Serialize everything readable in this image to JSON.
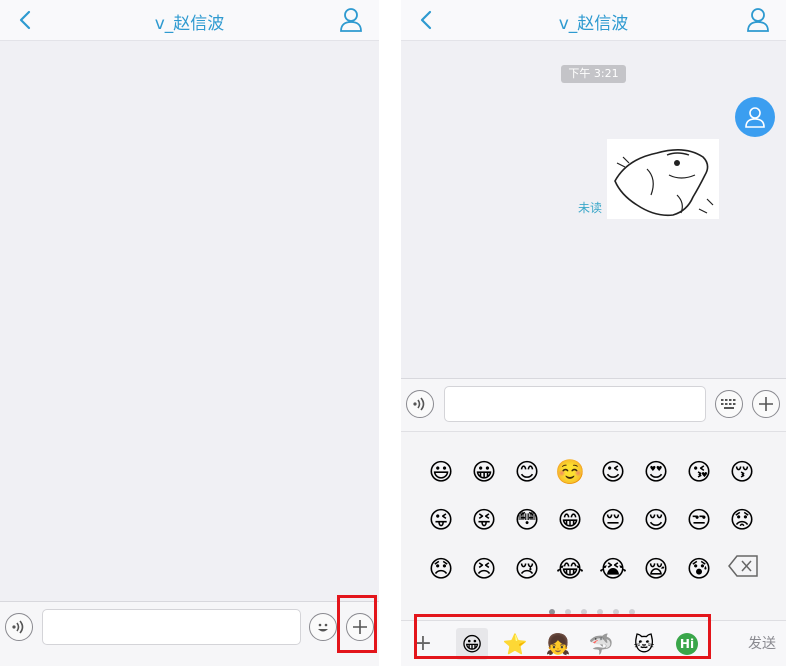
{
  "left_screen": {
    "header": {
      "title": "v_赵信波"
    }
  },
  "right_screen": {
    "header": {
      "title": "v_赵信波"
    },
    "messages": {
      "time": "下午 3:21",
      "unread_label": "未读"
    },
    "emoji_panel": {
      "rows": [
        [
          "😃",
          "😀",
          "😊",
          "☺️",
          "😉",
          "😍",
          "😘",
          "😚"
        ],
        [
          "😜",
          "😝",
          "😳",
          "😁",
          "😔",
          "😌",
          "😒",
          "😟"
        ],
        [
          "😞",
          "😣",
          "😢",
          "😂",
          "😭",
          "😪",
          "😰"
        ]
      ],
      "page_count": 6,
      "active_page": 0,
      "tabs": [
        "😀",
        "⭐",
        "👧",
        "🦈",
        "🐱",
        "Hi"
      ],
      "send_label": "发送"
    }
  },
  "colors": {
    "accent": "#2e9ad0",
    "highlight": "#e3151b",
    "avatar": "#3b9ef0"
  },
  "icons": [
    "back-arrow-icon",
    "person-icon",
    "voice-icon",
    "emoji-face-icon",
    "plus-icon",
    "keyboard-icon",
    "backspace-icon"
  ]
}
